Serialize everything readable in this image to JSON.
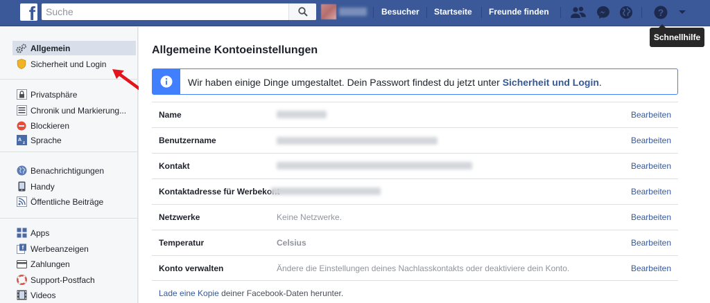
{
  "header": {
    "search_placeholder": "Suche",
    "nav": [
      "Besucher",
      "Startseite",
      "Freunde finden"
    ],
    "tooltip": "Schnellhilfe",
    "brand_color": "#3b5998"
  },
  "sidebar": {
    "groups": [
      [
        {
          "label": "Allgemein",
          "icon": "gears-icon",
          "active": true
        },
        {
          "label": "Sicherheit und Login",
          "icon": "badge-icon",
          "active": false
        }
      ],
      [
        {
          "label": "Privatsphäre",
          "icon": "lock-icon"
        },
        {
          "label": "Chronik und Markierung...",
          "icon": "timeline-icon"
        },
        {
          "label": "Blockieren",
          "icon": "block-icon"
        },
        {
          "label": "Sprache",
          "icon": "language-icon"
        }
      ],
      [
        {
          "label": "Benachrichtigungen",
          "icon": "globe-icon"
        },
        {
          "label": "Handy",
          "icon": "mobile-icon"
        },
        {
          "label": "Öffentliche Beiträge",
          "icon": "rss-icon"
        }
      ],
      [
        {
          "label": "Apps",
          "icon": "apps-icon"
        },
        {
          "label": "Werbeanzeigen",
          "icon": "ads-icon"
        },
        {
          "label": "Zahlungen",
          "icon": "card-icon"
        },
        {
          "label": "Support-Postfach",
          "icon": "lifebuoy-icon"
        },
        {
          "label": "Videos",
          "icon": "film-icon"
        }
      ]
    ]
  },
  "main": {
    "title": "Allgemeine Kontoeinstellungen",
    "notice": {
      "text": "Wir haben einige Dinge umgestaltet. Dein Passwort findest du jetzt unter ",
      "link": "Sicherheit und Login",
      "suffix": "."
    },
    "edit_label": "Bearbeiten",
    "rows": [
      {
        "label": "Name",
        "value": ""
      },
      {
        "label": "Benutzername",
        "value": ""
      },
      {
        "label": "Kontakt",
        "value": ""
      },
      {
        "label": "Kontaktadresse für Werbekont",
        "value": ""
      },
      {
        "label": "Netzwerke",
        "value": "Keine Netzwerke."
      },
      {
        "label": "Temperatur",
        "value": "Celsius"
      },
      {
        "label": "Konto verwalten",
        "value": "Ändere die Einstellungen deines Nachlasskontakts oder deaktiviere dein Konto."
      }
    ],
    "footer": {
      "link": "Lade eine Kopie",
      "text": " deiner Facebook-Daten herunter."
    }
  }
}
